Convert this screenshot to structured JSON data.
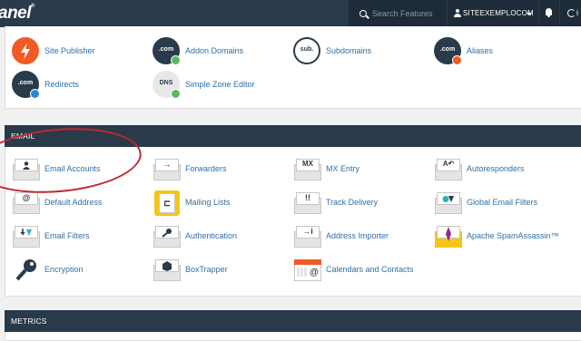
{
  "header": {
    "logo_text": "anel",
    "logo_reg": "®",
    "search_placeholder": "Search Features",
    "username": "SITEEXEMPLOCOM",
    "logout_glyph": "i"
  },
  "domains": {
    "items": [
      {
        "label": "Site Publisher",
        "icon": "lightning-bolt-icon",
        "color": "#f15a24"
      },
      {
        "label": "Addon Domains",
        "icon": "dotcom-plus-icon",
        "color": "#293a4a",
        "glyph": ".com"
      },
      {
        "label": "Subdomains",
        "icon": "sub-domain-icon",
        "color": "#ffffff",
        "glyph": "sub."
      },
      {
        "label": "Aliases",
        "icon": "dotcom-alias-icon",
        "color": "#293a4a",
        "glyph": ".com"
      },
      {
        "label": "Redirects",
        "icon": "dotcom-redirect-icon",
        "color": "#293a4a",
        "glyph": ".com"
      },
      {
        "label": "Simple Zone Editor",
        "icon": "dns-icon",
        "color": "#e8e8e8",
        "glyph": "DNS"
      }
    ]
  },
  "email": {
    "title": "EMAIL",
    "items": [
      {
        "label": "Email Accounts",
        "icon": "email-account-icon",
        "glyph": "👤"
      },
      {
        "label": "Forwarders",
        "icon": "forwarder-arrow-icon",
        "glyph": "→"
      },
      {
        "label": "MX Entry",
        "icon": "mx-entry-icon",
        "glyph": "MX"
      },
      {
        "label": "Autoresponders",
        "icon": "autoresponder-icon",
        "glyph": "A↶"
      },
      {
        "label": "Default Address",
        "icon": "default-address-at-icon",
        "glyph": "@"
      },
      {
        "label": "Mailing Lists",
        "icon": "mailing-list-icon",
        "glyph": "⊏"
      },
      {
        "label": "Track Delivery",
        "icon": "track-delivery-icon",
        "glyph": "!!"
      },
      {
        "label": "Global Email Filters",
        "icon": "global-filter-icon",
        "glyph": "●▼"
      },
      {
        "label": "Email Filters",
        "icon": "email-filter-icon",
        "glyph": "↓▼"
      },
      {
        "label": "Authentication",
        "icon": "key-authentication-icon",
        "glyph": "🔑"
      },
      {
        "label": "Address Importer",
        "icon": "address-importer-icon",
        "glyph": "→i"
      },
      {
        "label": "Apache SpamAssassin™",
        "icon": "spamassassin-icon",
        "glyph": "✦"
      },
      {
        "label": "Encryption",
        "icon": "encryption-key-icon",
        "glyph": "🔑"
      },
      {
        "label": "BoxTrapper",
        "icon": "boxtrapper-icon",
        "glyph": "▣"
      },
      {
        "label": "Calendars and Contacts",
        "icon": "calendar-contacts-icon",
        "glyph": "@"
      }
    ]
  },
  "metrics": {
    "title": "METRICS"
  },
  "colors": {
    "header_bg": "#293a4a",
    "link": "#2f6fa7",
    "annotation": "#c1272d"
  }
}
